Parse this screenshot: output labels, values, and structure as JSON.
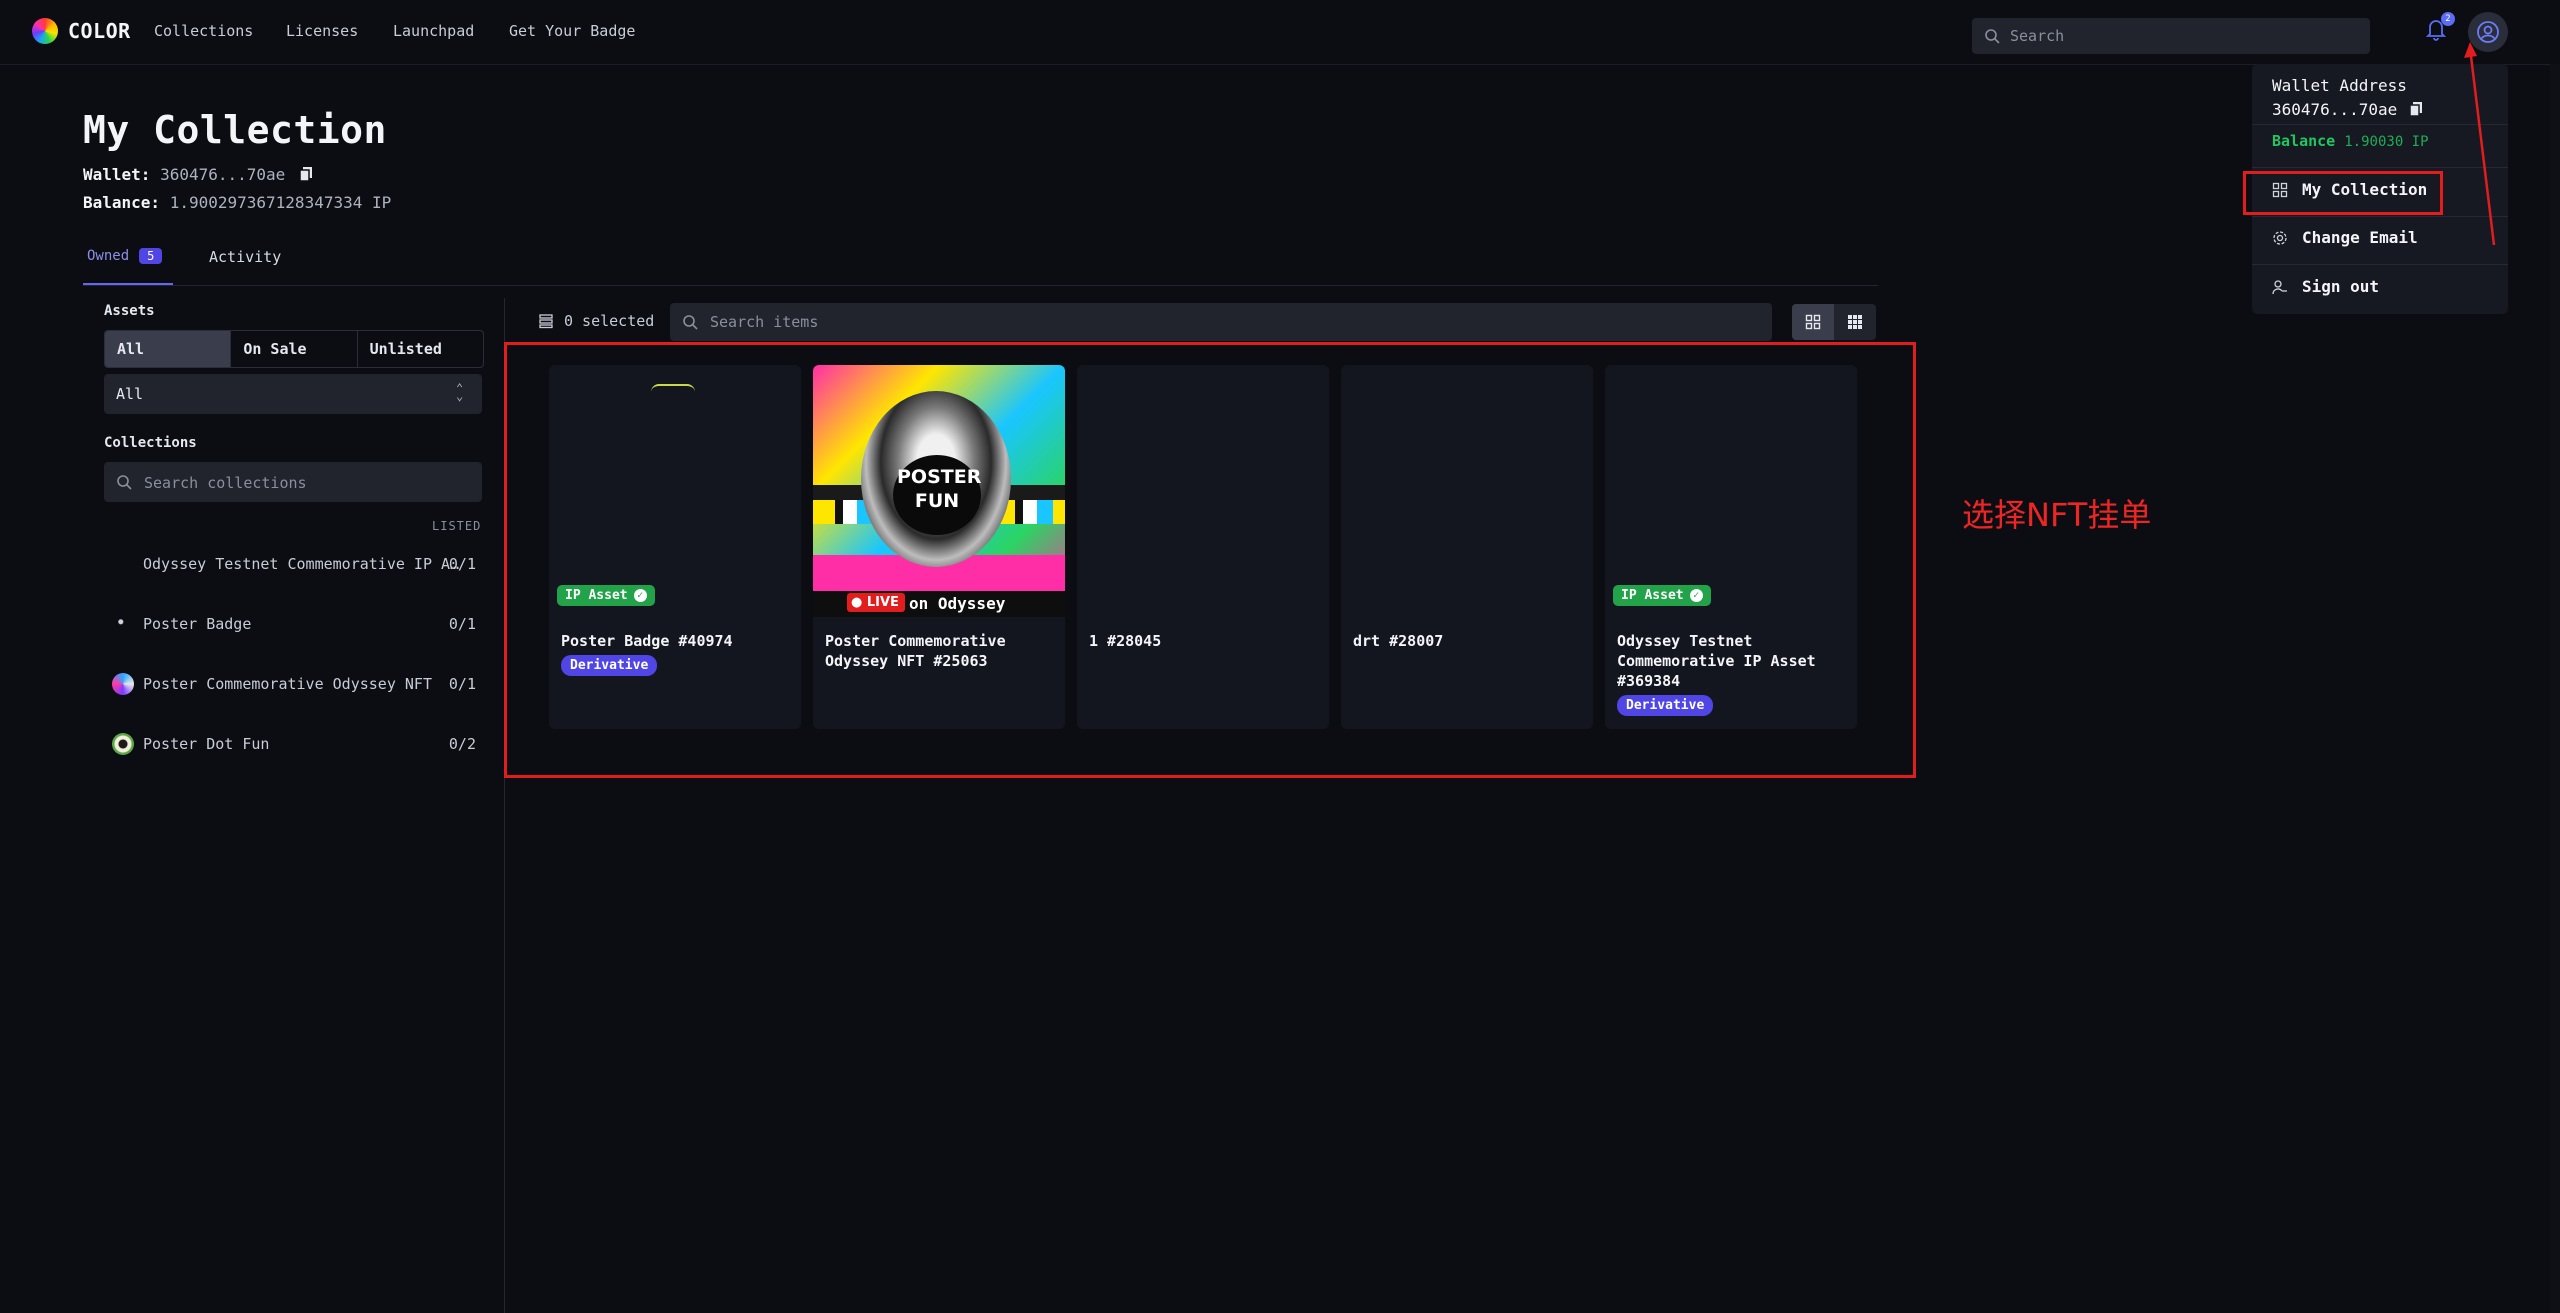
{
  "app": {
    "name": "COLOR"
  },
  "nav": {
    "items": [
      "Collections",
      "Licenses",
      "Launchpad",
      "Get Your Badge"
    ]
  },
  "header": {
    "search_placeholder": "Search",
    "notification_count": "2"
  },
  "page": {
    "title": "My Collection",
    "wallet_label": "Wallet:",
    "wallet_value": "360476...70ae",
    "balance_label": "Balance:",
    "balance_value": "1.900297367128347334 IP"
  },
  "tabs": {
    "owned_label": "Owned",
    "owned_count": "5",
    "activity_label": "Activity"
  },
  "sidebar": {
    "assets_label": "Assets",
    "filters": [
      "All",
      "On Sale",
      "Unlisted"
    ],
    "type_select": "All",
    "collections_label": "Collections",
    "collections_search_placeholder": "Search collections",
    "listed_header": "LISTED",
    "collections": [
      {
        "name": "Odyssey Testnet Commemorative IP A…",
        "count": "0/1"
      },
      {
        "name": "Poster Badge",
        "count": "0/1"
      },
      {
        "name": "Poster Commemorative Odyssey NFT",
        "count": "0/1"
      },
      {
        "name": "Poster Dot Fun",
        "count": "0/2"
      }
    ]
  },
  "toolbar": {
    "selected_text": "0 selected",
    "search_placeholder": "Search items"
  },
  "cards": [
    {
      "title": "Poster Badge #40974",
      "ip_badge": "IP Asset",
      "tag": "Derivative"
    },
    {
      "title": "Poster Commemorative Odyssey NFT #25063",
      "image_text": "POSTER FUN",
      "live": "LIVE",
      "on_text": "on Odyssey"
    },
    {
      "title": "1 #28045"
    },
    {
      "title": "drt #28007"
    },
    {
      "title": "Odyssey Testnet Commemorative IP Asset #369384",
      "ip_badge": "IP Asset",
      "tag": "Derivative"
    }
  ],
  "annotation": {
    "text": "选择NFT挂单"
  },
  "menu": {
    "wallet_label": "Wallet Address",
    "wallet_value": "360476...70ae",
    "balance_label": "Balance",
    "balance_value": "1.90030 IP",
    "items": [
      "My Collection",
      "Change Email",
      "Sign out"
    ]
  },
  "colors": {
    "accent": "#6366f1",
    "success": "#22a34a",
    "annotation": "#e11d1d",
    "background": "#0c0d13"
  }
}
